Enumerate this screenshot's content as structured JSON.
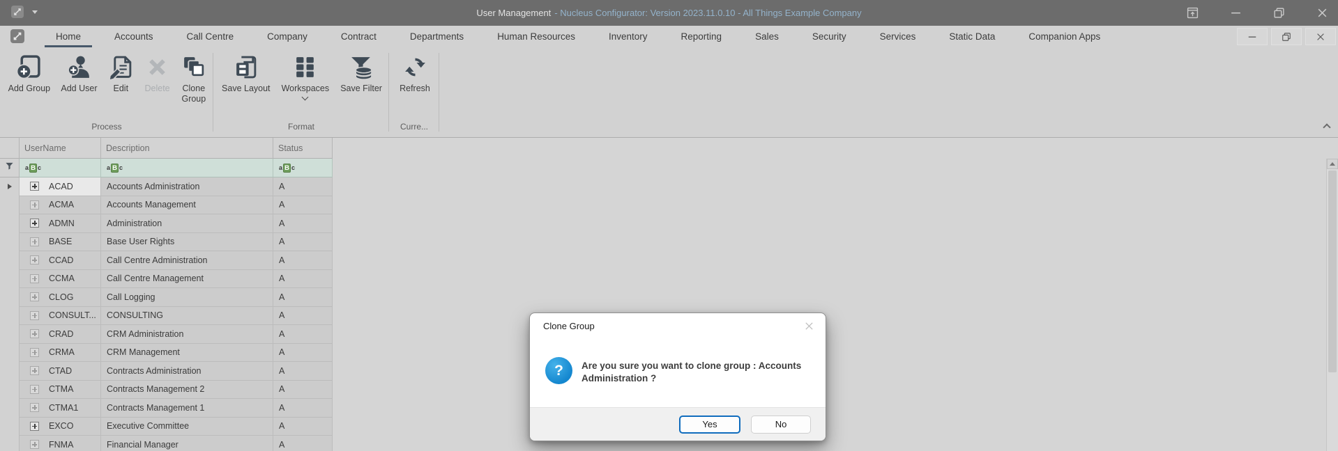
{
  "titlebar": {
    "title_primary": "User Management",
    "title_secondary": "- Nucleus Configurator: Version 2023.11.0.10 - All Things Example Company"
  },
  "ribbon_tabs": [
    {
      "label": "Home",
      "state": "selected"
    },
    {
      "label": "Accounts"
    },
    {
      "label": "Call Centre"
    },
    {
      "label": "Company"
    },
    {
      "label": "Contract"
    },
    {
      "label": "Departments"
    },
    {
      "label": "Human Resources"
    },
    {
      "label": "Inventory"
    },
    {
      "label": "Reporting"
    },
    {
      "label": "Sales"
    },
    {
      "label": "Security"
    },
    {
      "label": "Services"
    },
    {
      "label": "Static Data"
    },
    {
      "label": "Companion Apps"
    }
  ],
  "ribbon_groups": {
    "process": {
      "label": "Process",
      "buttons": [
        {
          "label": "Add Group",
          "icon": "add-group"
        },
        {
          "label": "Add User",
          "icon": "add-user"
        },
        {
          "label": "Edit",
          "icon": "edit"
        },
        {
          "label": "Delete",
          "icon": "delete",
          "state": "disabled"
        },
        {
          "label": "Clone\nGroup",
          "icon": "clone-group"
        }
      ]
    },
    "format": {
      "label": "Format",
      "buttons": [
        {
          "label": "Save Layout",
          "icon": "save-layout"
        },
        {
          "label": "Workspaces",
          "icon": "workspaces",
          "state": "has-dd"
        },
        {
          "label": "Save Filter",
          "icon": "save-filter"
        }
      ]
    },
    "current": {
      "label": "Curre...",
      "buttons": [
        {
          "label": "Refresh",
          "icon": "refresh"
        }
      ]
    }
  },
  "grid": {
    "headers": {
      "username": "UserName",
      "description": "Description",
      "status": "Status"
    },
    "filter_glyph": {
      "a": "a",
      "b": "B",
      "c": "c"
    },
    "rows": [
      {
        "username": "ACAD",
        "description": "Accounts Administration",
        "status": "A",
        "state": "focused plus-strong"
      },
      {
        "username": "ACMA",
        "description": "Accounts Management",
        "status": "A"
      },
      {
        "username": "ADMN",
        "description": "Administration",
        "status": "A",
        "state": "plus-strong"
      },
      {
        "username": "BASE",
        "description": "Base User Rights",
        "status": "A"
      },
      {
        "username": "CCAD",
        "description": "Call Centre Administration",
        "status": "A"
      },
      {
        "username": "CCMA",
        "description": "Call Centre Management",
        "status": "A"
      },
      {
        "username": "CLOG",
        "description": "Call Logging",
        "status": "A"
      },
      {
        "username": "CONSULT...",
        "description": "CONSULTING",
        "status": "A"
      },
      {
        "username": "CRAD",
        "description": "CRM Administration",
        "status": "A"
      },
      {
        "username": "CRMA",
        "description": "CRM Management",
        "status": "A"
      },
      {
        "username": "CTAD",
        "description": "Contracts Administration",
        "status": "A"
      },
      {
        "username": "CTMA",
        "description": "Contracts Management 2",
        "status": "A"
      },
      {
        "username": "CTMA1",
        "description": "Contracts Management 1",
        "status": "A"
      },
      {
        "username": "EXCO",
        "description": "Executive Committee",
        "status": "A",
        "state": "plus-strong"
      },
      {
        "username": "FNMA",
        "description": "Financial Manager",
        "status": "A"
      }
    ]
  },
  "dialog": {
    "title": "Clone Group",
    "icon_glyph": "?",
    "message": "Are you sure you want to clone group : Accounts Administration ?",
    "yes_label": "Yes",
    "no_label": "No"
  },
  "colors": {
    "titlebar_bg": "#6c6c6c",
    "title_secondary_text": "#94b3cb",
    "ribbon_bg": "#d2d2d2",
    "ribbon_icon": "#3e4a55",
    "tab_underline": "#47586a",
    "filter_row_bg": "#cfdfd8",
    "filter_glyph_green": "#6f9e5d",
    "dialog_accent_blue": "#0f6cbd",
    "dialog_icon_blue": "#1487cf"
  }
}
